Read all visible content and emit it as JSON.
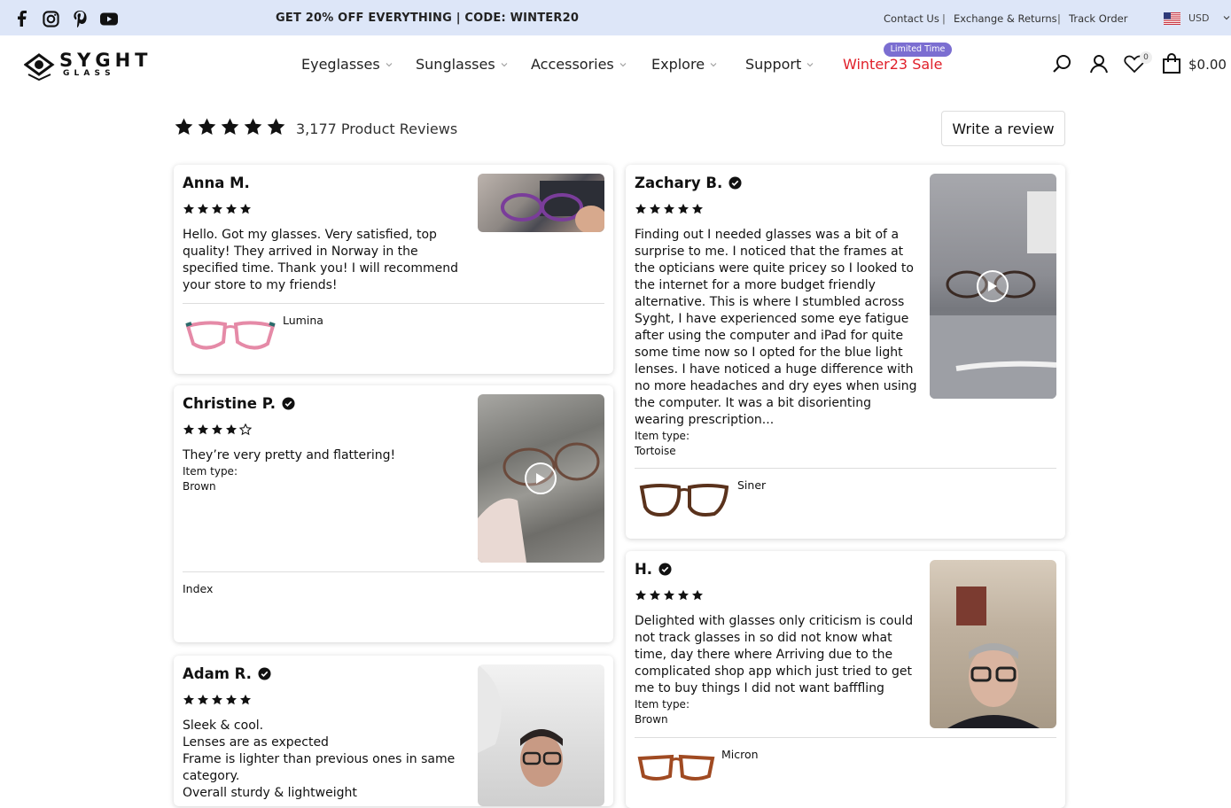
{
  "topbar": {
    "promo": "GET 20% OFF EVERYTHING | CODE: WINTER20",
    "links": [
      "Contact Us",
      "Exchange & Returns",
      "Track Order"
    ],
    "separator": "|",
    "currency": "USD",
    "social_icons": [
      "facebook-icon",
      "instagram-icon",
      "pinterest-icon",
      "youtube-icon"
    ]
  },
  "brand": {
    "name": "SYGHT",
    "sub": "G L A S S"
  },
  "nav": {
    "items": [
      "Eyeglasses",
      "Sunglasses",
      "Accessories",
      "Explore",
      "Support"
    ],
    "sale": "Winter23 Sale",
    "sale_badge": "Limited Time",
    "sale_color": "#e0202a",
    "badge_color": "#7b6ed1"
  },
  "header": {
    "wishlist_count": "0",
    "cart_total": "$0.00"
  },
  "summary": {
    "rating": 5,
    "count_label": "3,177 Product Reviews",
    "write_review": "Write a review"
  },
  "reviews": [
    {
      "name": "Anna M.",
      "verified": false,
      "rating": 5,
      "text": "Hello. Got my glasses. Very satisfied, top quality! They arrived in Norway in the specified time. Thank you! I will recommend your store to my friends!",
      "product": "Lumina",
      "video": false
    },
    {
      "name": "Zachary B.",
      "verified": true,
      "rating": 5,
      "text": "Finding out I needed glasses was a bit of a surprise to me. I noticed that the frames at the opticians were quite pricey so I looked to the internet for a more budget friendly alternative. This is where I stumbled across Syght, I have experienced some eye fatigue after using the computer and iPad for quite some time now so I opted for the blue light lenses. I have noticed a huge difference with no more headaches and dry eyes when using the computer. It was a bit disorienting wearing prescription...",
      "item_type_label": "Item type:",
      "item_type": "Tortoise",
      "product": "Siner",
      "video": true
    },
    {
      "name": "Christine P.",
      "verified": true,
      "rating": 4,
      "text": "They’re very pretty and flattering!",
      "item_type_label": "Item type:",
      "item_type": "Brown",
      "product": "Index",
      "video": true
    },
    {
      "name": "H.",
      "verified": true,
      "rating": 5,
      "text": "Delighted with glasses only criticism is could not track glasses in so did not know what time, day there where Arriving due to the complicated shop app which just tried to get me to buy things I did not want bafffling",
      "item_type_label": "Item type:",
      "item_type": "Brown",
      "product": "Micron",
      "video": false
    },
    {
      "name": "Adam R.",
      "verified": true,
      "rating": 5,
      "text_lines": [
        "Sleek & cool.",
        "Lenses are as expected",
        "Frame is lighter than previous ones in same category.",
        "Overall sturdy & lightweight"
      ],
      "video": false
    }
  ]
}
